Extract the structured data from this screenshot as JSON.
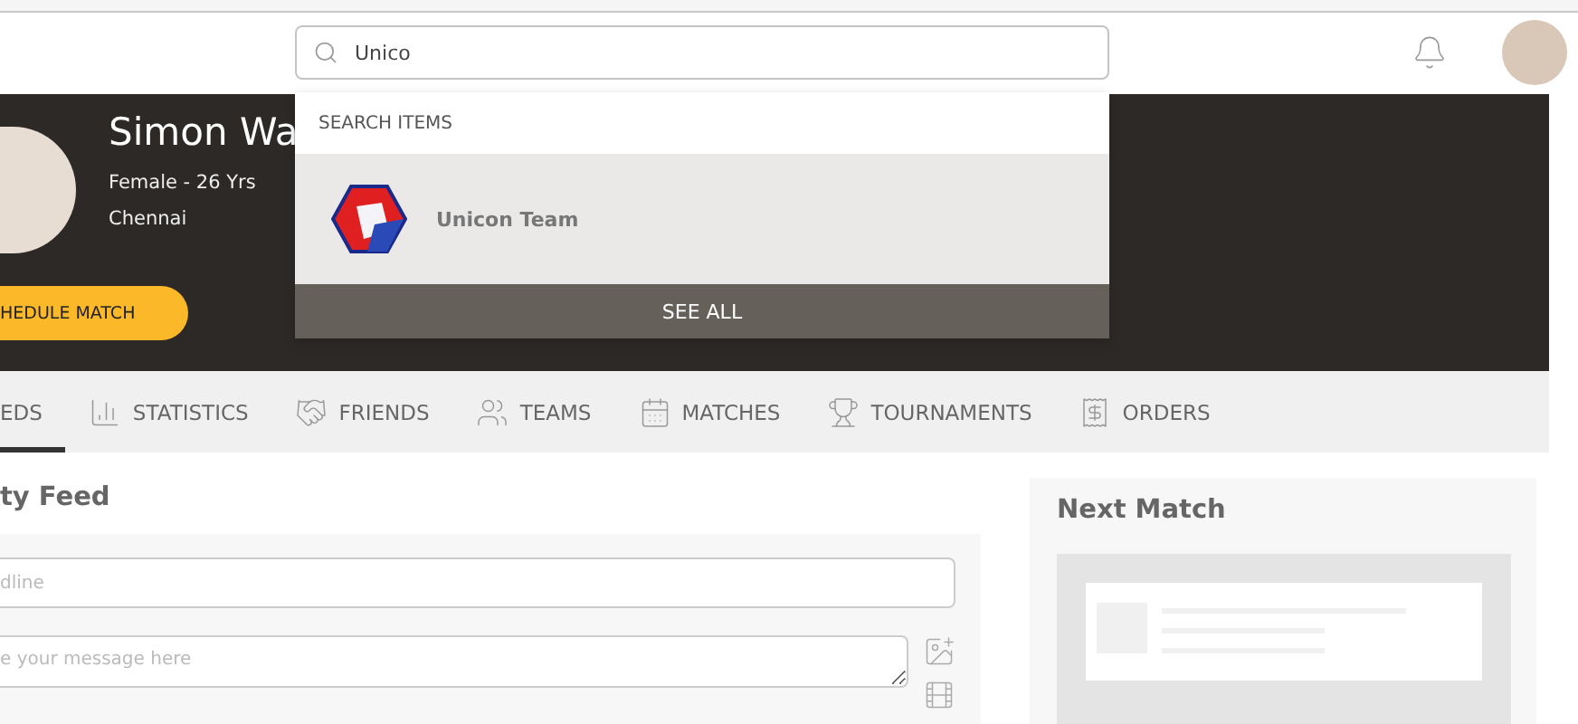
{
  "search": {
    "value": "Unico",
    "dropdown": {
      "heading": "SEARCH ITEMS",
      "results": [
        {
          "name": "Unicon Team",
          "selected": true
        }
      ],
      "see_all": "SEE ALL"
    }
  },
  "profile": {
    "name": "Simon Wa",
    "gender_age": "Female - 26 Yrs",
    "city": "Chennai",
    "button": "HEDULE MATCH"
  },
  "tabs": [
    {
      "label": "EDS",
      "selected": true
    },
    {
      "label": "STATISTICS",
      "selected": false
    },
    {
      "label": "FRIENDS",
      "selected": false
    },
    {
      "label": "TEAMS",
      "selected": false
    },
    {
      "label": "MATCHES",
      "selected": false
    },
    {
      "label": "TOURNAMENTS",
      "selected": false
    },
    {
      "label": "ORDERS",
      "selected": false
    }
  ],
  "feed": {
    "title": "ty Feed",
    "headline_placeholder": "dline",
    "message_placeholder": "e your message here"
  },
  "next_match": {
    "title": "Next Match"
  }
}
